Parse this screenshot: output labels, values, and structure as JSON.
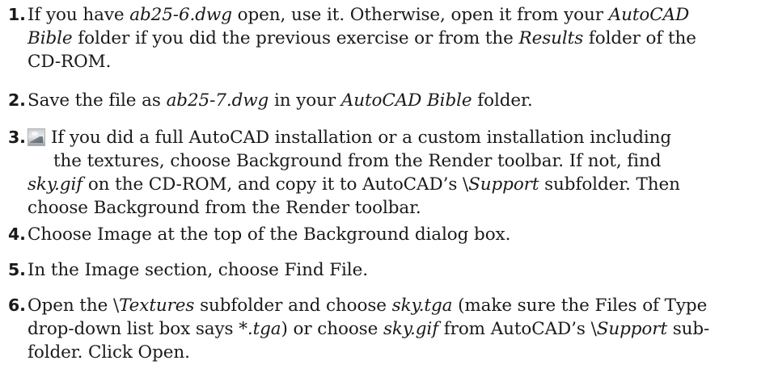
{
  "steps": [
    {
      "num": "1.",
      "t1": "If you have ",
      "f1": "ab25-6.dwg",
      "t2": " open, use it. Otherwise, open it from your ",
      "f2": "AutoCAD",
      "f3": "Bible",
      "t3": " folder if you did the previous exercise or from the ",
      "f4": "Results",
      "t4": " folder of the",
      "t5": "CD-ROM."
    },
    {
      "num": "2.",
      "t1": "Save the file as ",
      "f1": "ab25-7.dwg",
      "t2": " in your ",
      "f2": "AutoCAD Bible",
      "t3": " folder."
    },
    {
      "num": "3.",
      "icon": "background-toolbar-icon",
      "t1": "If you did a full AutoCAD installation or a custom installation including",
      "t2": "the textures, choose Background from the Render toolbar. If not, find",
      "f1": "sky.gif",
      "t3": " on the CD-ROM, and copy it to AutoCAD’s \\",
      "f2": "Support",
      "t4": " subfolder. Then",
      "t5": "choose Background from the Render toolbar."
    },
    {
      "num": "4.",
      "t1": "Choose Image at the top of the Background dialog box."
    },
    {
      "num": "5.",
      "t1": "In the Image section, choose Find File."
    },
    {
      "num": "6.",
      "t1": "Open the \\",
      "f1": "Textures",
      "t2": " subfolder and choose ",
      "f2": "sky.tga",
      "t3": " (make sure the Files of Type",
      "t4": "drop-down list box says *",
      "f3": ".tga",
      "t5": ") or choose ",
      "f4": "sky.gif",
      "t6": " from AutoCAD’s \\",
      "f5": "Support",
      "t7": " sub-",
      "t8": "folder. Click Open."
    }
  ]
}
